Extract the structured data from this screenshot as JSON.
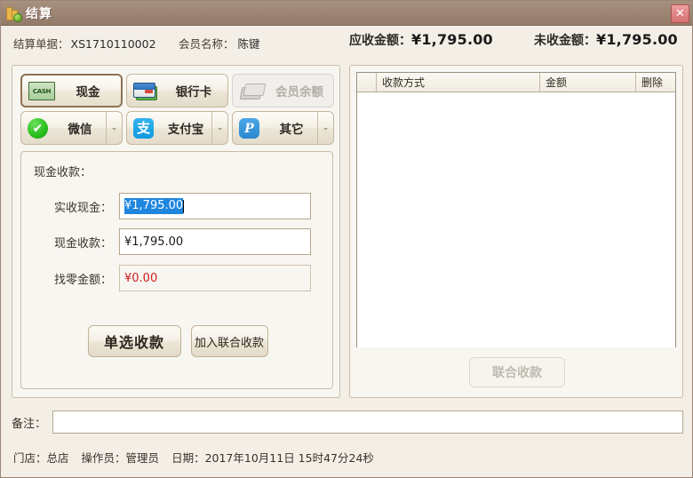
{
  "window": {
    "title": "结算",
    "icon": "coins-icon",
    "close_label": "✕"
  },
  "header": {
    "order_label": "结算单据：",
    "order_value": "XS1710110002",
    "member_label": "会员名称：",
    "member_value": "陈键",
    "receivable_label": "应收金额：",
    "receivable_value": "¥1,795.00",
    "unpaid_label": "未收金额：",
    "unpaid_value": "¥1,795.00"
  },
  "payment_methods": [
    {
      "label": "现金",
      "icon": "cash-icon",
      "selected": true,
      "disabled": false,
      "has_dropdown": false
    },
    {
      "label": "银行卡",
      "icon": "card-icon",
      "selected": false,
      "disabled": false,
      "has_dropdown": false
    },
    {
      "label": "会员余额",
      "icon": "member-card-icon",
      "selected": false,
      "disabled": true,
      "has_dropdown": false
    },
    {
      "label": "微信",
      "icon": "wechat-icon",
      "selected": false,
      "disabled": false,
      "has_dropdown": true
    },
    {
      "label": "支付宝",
      "icon": "alipay-icon",
      "selected": false,
      "disabled": false,
      "has_dropdown": true
    },
    {
      "label": "其它",
      "icon": "paypal-icon",
      "selected": false,
      "disabled": false,
      "has_dropdown": true
    }
  ],
  "icon_glyphs": {
    "cash": "CASH",
    "wechat": "✔",
    "alipay": "支",
    "other": "P",
    "dropdown": "⌄"
  },
  "cash_form": {
    "group_title": "现金收款：",
    "fields": [
      {
        "label": "实收现金：",
        "value": "¥1,795.00",
        "selected": true,
        "readonly": false
      },
      {
        "label": "现金收款：",
        "value": "¥1,795.00",
        "selected": false,
        "readonly": false
      },
      {
        "label": "找零金额：",
        "value": "¥0.00",
        "selected": false,
        "readonly": true
      }
    ],
    "primary_button": "单选收款",
    "secondary_button": "加入联合收款"
  },
  "receipt_grid": {
    "columns": [
      "",
      "收款方式",
      "金额",
      "删除"
    ],
    "rows": [],
    "joint_button": "联合收款",
    "joint_button_disabled": true
  },
  "footer": {
    "remark_label": "备注：",
    "remark_value": "",
    "store_label": "门店：",
    "store_value": "总店",
    "operator_label": "操作员：",
    "operator_value": "管理员",
    "date_label": "日期：",
    "date_value": "2017年10月11日 15时47分24秒"
  },
  "colors": {
    "titlebar": "#9c8473",
    "panel_bg": "#f8f6f1",
    "window_bg": "#f3efe7",
    "border": "#c9bda9",
    "selection": "#1f86e0",
    "change_amount": "#d02020",
    "close_button": "#e08585"
  }
}
